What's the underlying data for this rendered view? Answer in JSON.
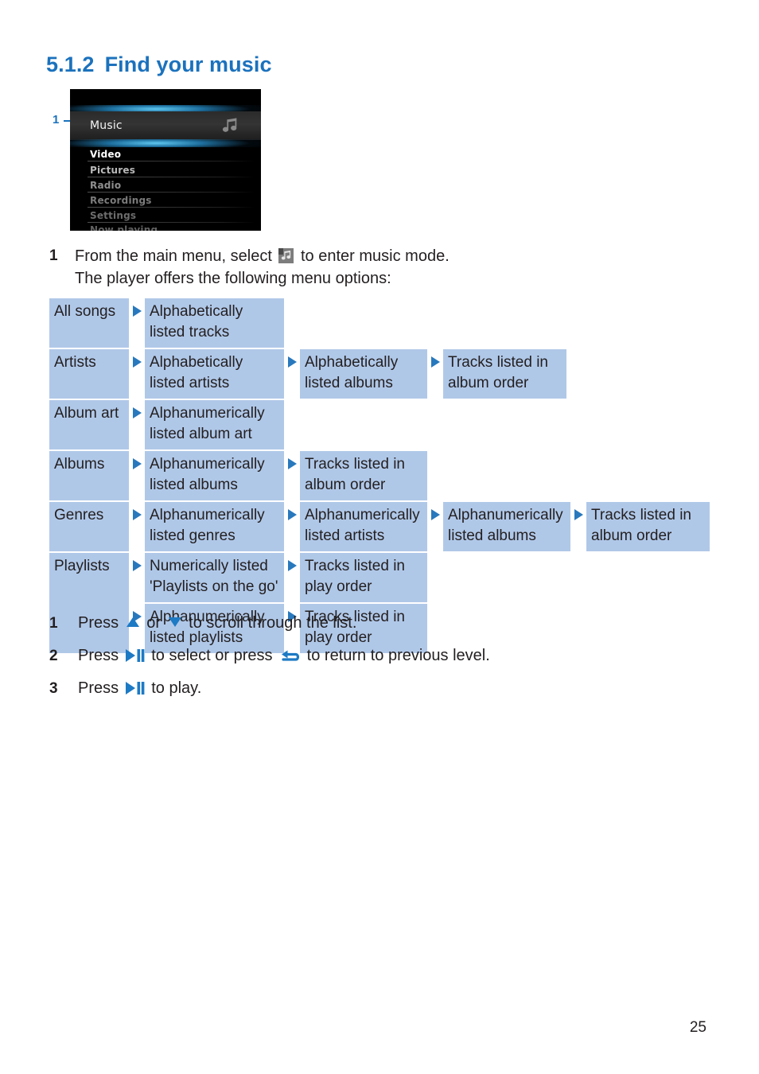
{
  "heading": {
    "number": "5.1.2",
    "title": "Find your music"
  },
  "callout": {
    "label": "1"
  },
  "device_screen": {
    "selected_item": "Music",
    "selected_icon": "music-note-icon",
    "items": [
      "Video",
      "Pictures",
      "Radio",
      "Recordings",
      "Settings",
      "Now playing"
    ]
  },
  "intro_step": {
    "number": "1",
    "line1_before": "From the main menu, select",
    "line1_icon": "music-mode-icon",
    "line1_after": "to enter music mode.",
    "line2": "The player offers the following menu options:"
  },
  "flow_table": {
    "rows": [
      {
        "label": "All songs",
        "cols": [
          "Alphabetically listed tracks"
        ]
      },
      {
        "label": "Artists",
        "cols": [
          "Alphabetically listed artists",
          "Alphabetically listed albums",
          "Tracks listed in album order"
        ]
      },
      {
        "label": "Album art",
        "cols": [
          "Alphanumerically listed album art"
        ]
      },
      {
        "label": "Albums",
        "cols": [
          "Alphanumerically listed albums",
          "Tracks listed in album order"
        ]
      },
      {
        "label": "Genres",
        "cols": [
          "Alphanumerically listed genres",
          "Alphanumerically listed artists",
          "Alphanumerically listed albums",
          "Tracks listed in album order"
        ]
      },
      {
        "label": "Playlists",
        "sub_rows": [
          [
            "Numerically listed 'Playlists on the go'",
            "Tracks listed in play order"
          ],
          [
            "Alphanumerically listed playlists",
            "Tracks listed in play order"
          ]
        ]
      }
    ]
  },
  "bottom_steps": [
    {
      "number": "1",
      "parts": [
        "Press",
        "up-triangle-icon",
        "or",
        "down-triangle-icon",
        "to scroll through the list."
      ]
    },
    {
      "number": "2",
      "parts": [
        "Press",
        "play-pause-icon",
        "to select or press",
        "return-arrow-icon",
        "to return to previous level."
      ]
    },
    {
      "number": "3",
      "parts": [
        "Press",
        "play-pause-icon",
        "to play."
      ]
    }
  ],
  "bottom_step_text": {
    "s1_a": "Press",
    "s1_b": "or",
    "s1_c": "to scroll through the list.",
    "s2_a": "Press",
    "s2_b": "to select or press",
    "s2_c": "to return to previous level.",
    "s3_a": "Press",
    "s3_b": "to play."
  },
  "page_number": "25",
  "colors": {
    "heading_blue": "#1b72bd",
    "cell_blue": "#b0c8e8",
    "arrow_blue": "#2878bd",
    "glyph_blue": "#1d7ac4",
    "text_black": "#231f20"
  }
}
